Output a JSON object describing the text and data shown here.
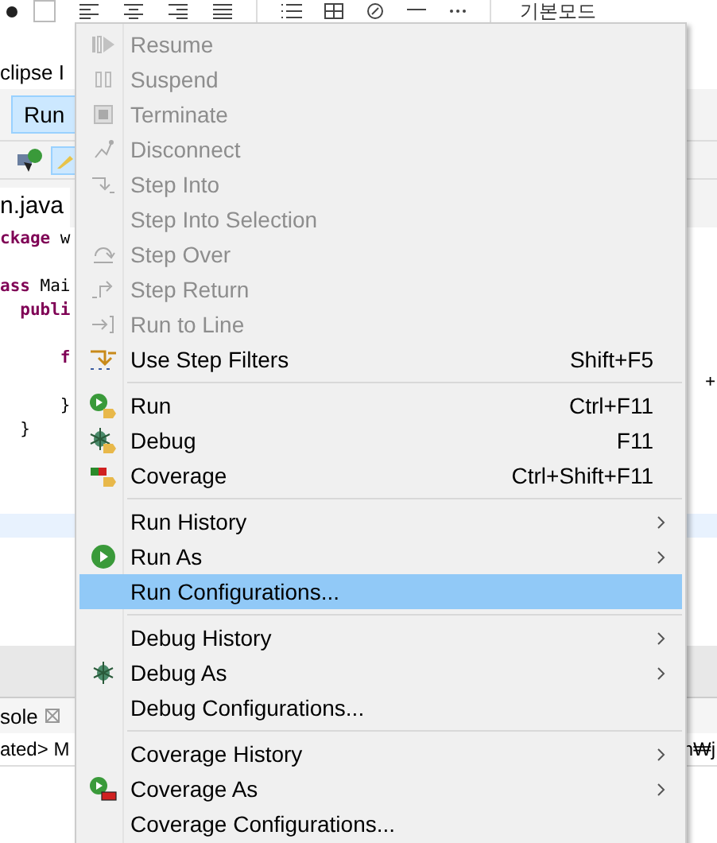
{
  "top_toolbar": {
    "mode_label": "기본모드"
  },
  "window_title": "clipse I",
  "menubar": [
    {
      "label": "Run",
      "selected": true
    }
  ],
  "editor_tab": {
    "label": "n.java"
  },
  "code_lines": [
    {
      "kind": "code",
      "segments": [
        {
          "text": "ckage",
          "kind": "keyword"
        },
        {
          "text": " w",
          "kind": "plain"
        }
      ]
    },
    {
      "kind": "blank"
    },
    {
      "kind": "code",
      "segments": [
        {
          "text": "ass",
          "kind": "keyword"
        },
        {
          "text": " Mai",
          "kind": "plain"
        }
      ]
    },
    {
      "kind": "code",
      "segments": [
        {
          "text": "  publi",
          "kind": "keyword"
        }
      ]
    },
    {
      "kind": "blank"
    },
    {
      "kind": "code",
      "segments": [
        {
          "text": "      f",
          "kind": "keyword"
        }
      ]
    },
    {
      "kind": "code",
      "tail": "+"
    },
    {
      "kind": "code",
      "segments": [
        {
          "text": "      }",
          "kind": "plain"
        }
      ]
    },
    {
      "kind": "code",
      "segments": [
        {
          "text": "  }",
          "kind": "plain"
        }
      ]
    }
  ],
  "console": {
    "tab": "sole",
    "line": "ated> M",
    "line_tail": "n₩j"
  },
  "menu": [
    {
      "kind": "item",
      "label": "Resume",
      "disabled": true,
      "submenu": false,
      "selected": false
    },
    {
      "kind": "item",
      "label": "Suspend",
      "disabled": true,
      "submenu": false,
      "selected": false
    },
    {
      "kind": "item",
      "label": "Terminate",
      "disabled": true,
      "submenu": false,
      "selected": false
    },
    {
      "kind": "item",
      "label": "Disconnect",
      "disabled": true,
      "submenu": false,
      "selected": false
    },
    {
      "kind": "item",
      "label": "Step Into",
      "disabled": true,
      "submenu": false,
      "selected": false
    },
    {
      "kind": "item",
      "label": "Step Into Selection",
      "disabled": true,
      "submenu": false,
      "selected": false
    },
    {
      "kind": "item",
      "label": "Step Over",
      "disabled": true,
      "submenu": false,
      "selected": false
    },
    {
      "kind": "item",
      "label": "Step Return",
      "disabled": true,
      "submenu": false,
      "selected": false
    },
    {
      "kind": "item",
      "label": "Run to Line",
      "disabled": true,
      "submenu": false,
      "selected": false
    },
    {
      "kind": "item",
      "label": "Use Step Filters",
      "shortcut": "Shift+F5",
      "disabled": false,
      "submenu": false,
      "selected": false
    },
    {
      "kind": "separator"
    },
    {
      "kind": "item",
      "label": "Run",
      "shortcut": "Ctrl+F11",
      "disabled": false,
      "submenu": false,
      "selected": false
    },
    {
      "kind": "item",
      "label": "Debug",
      "shortcut": "F11",
      "disabled": false,
      "submenu": false,
      "selected": false
    },
    {
      "kind": "item",
      "label": "Coverage",
      "shortcut": "Ctrl+Shift+F11",
      "disabled": false,
      "submenu": false,
      "selected": false
    },
    {
      "kind": "separator"
    },
    {
      "kind": "item",
      "label": "Run History",
      "disabled": false,
      "submenu": true,
      "selected": false
    },
    {
      "kind": "item",
      "label": "Run As",
      "disabled": false,
      "submenu": true,
      "selected": false
    },
    {
      "kind": "item",
      "label": "Run Configurations...",
      "disabled": false,
      "submenu": false,
      "selected": true
    },
    {
      "kind": "separator"
    },
    {
      "kind": "item",
      "label": "Debug History",
      "disabled": false,
      "submenu": true,
      "selected": false
    },
    {
      "kind": "item",
      "label": "Debug As",
      "disabled": false,
      "submenu": true,
      "selected": false
    },
    {
      "kind": "item",
      "label": "Debug Configurations...",
      "disabled": false,
      "submenu": false,
      "selected": false
    },
    {
      "kind": "separator"
    },
    {
      "kind": "item",
      "label": "Coverage History",
      "disabled": false,
      "submenu": true,
      "selected": false
    },
    {
      "kind": "item",
      "label": "Coverage As",
      "disabled": false,
      "submenu": true,
      "selected": false
    },
    {
      "kind": "item",
      "label": "Coverage Configurations...",
      "disabled": false,
      "submenu": false,
      "selected": false
    }
  ]
}
